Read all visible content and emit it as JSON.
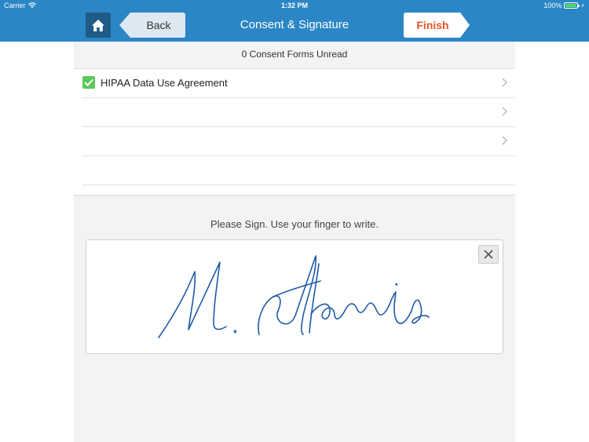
{
  "status_bar": {
    "carrier": "Carrier",
    "time": "1:32 PM",
    "battery": "100%"
  },
  "nav": {
    "title": "Consent & Signature",
    "back_label": "Back",
    "finish_label": "Finish",
    "home_icon": "home-icon"
  },
  "forms": {
    "unread_text": "0 Consent Forms Unread",
    "items": [
      {
        "label": "HIPAA Data Use Agreement",
        "checked": true
      },
      {
        "label": "",
        "checked": false
      },
      {
        "label": "",
        "checked": false
      },
      {
        "label": "",
        "checked": false
      }
    ]
  },
  "signature": {
    "prompt": "Please Sign. Use your finger to write.",
    "signed_name": "M. Harris",
    "ink_color": "#1f5aa8"
  },
  "colors": {
    "nav_bar": "#2b86c6",
    "home_button": "#1e5b86",
    "back_button": "#dde9f2",
    "finish_text": "#e8542a",
    "check_green": "#5cc85a",
    "content_bg": "#f3f3f3"
  }
}
